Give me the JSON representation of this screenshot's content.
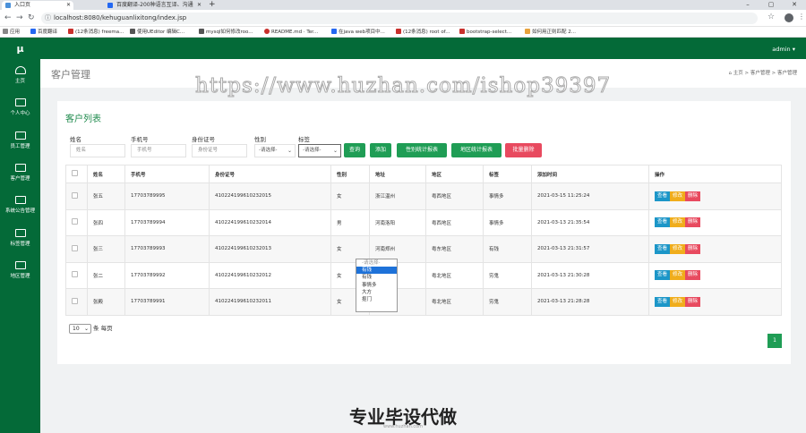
{
  "browser": {
    "tabs": [
      {
        "label": "入口页",
        "active": true
      },
      {
        "label": "百度翻译-200种语言互译、沟通",
        "active": false
      }
    ],
    "url": "localhost:8080/kehuguanlixitong/index.jsp",
    "bookmarks": [
      "应用",
      "百度翻译",
      "(12条消息) freema...",
      "使用UEditor 编辑C...",
      "mysql如何修改roo...",
      "README.md · Ter...",
      "在java web项目中...",
      "(12条消息) root of...",
      "bootstrap-select...",
      "如何用正则匹配 2..."
    ]
  },
  "sidebar": {
    "logo": "μ",
    "items": [
      {
        "label": "主页",
        "icon": "dashboard-icon"
      },
      {
        "label": "个人中心",
        "icon": "monitor-icon"
      },
      {
        "label": "员工管理",
        "icon": "monitor-icon"
      },
      {
        "label": "客户管理",
        "icon": "monitor-icon"
      },
      {
        "label": "系统公告管理",
        "icon": "monitor-icon"
      },
      {
        "label": "标签管理",
        "icon": "monitor-icon"
      },
      {
        "label": "地区管理",
        "icon": "monitor-icon"
      }
    ]
  },
  "topbar": {
    "user": "admin ▾"
  },
  "header": {
    "title": "客户管理",
    "breadcrumb": [
      "主页",
      "客户管理",
      "客户管理"
    ]
  },
  "watermark": "https://www.huzhan.com/ishop39397",
  "panel": {
    "title": "客户列表",
    "filters": {
      "name_label": "姓名",
      "name_placeholder": "姓名",
      "phone_label": "手机号",
      "phone_placeholder": "手机号",
      "idcard_label": "身份证号",
      "idcard_placeholder": "身份证号",
      "gender_label": "性别",
      "gender_value": "-请选择-",
      "tag_label": "标签",
      "tag_value": "-请选择-"
    },
    "buttons": {
      "search": "查询",
      "add": "添加",
      "gender_report": "性别统计报表",
      "region_report": "地区统计报表",
      "batch_delete": "批量删除"
    },
    "tag_options": [
      "-请选择-",
      "有钱",
      "有钱",
      "事情多",
      "大方",
      "抠门"
    ],
    "table": {
      "headers": [
        "",
        "姓名",
        "手机号",
        "身份证号",
        "性别",
        "地址",
        "地区",
        "标签",
        "添加时间",
        "操作"
      ],
      "rows": [
        {
          "name": "张五",
          "phone": "17703789995",
          "idcard": "410224199610232015",
          "gender": "女",
          "address": "浙江温州",
          "region": "粤西地区",
          "tag": "事情多",
          "time": "2021-03-15 11:25:24"
        },
        {
          "name": "张四",
          "phone": "17703789994",
          "idcard": "410224199610232014",
          "gender": "男",
          "address": "河南洛阳",
          "region": "粤西地区",
          "tag": "事情多",
          "time": "2021-03-13 21:35:54"
        },
        {
          "name": "张三",
          "phone": "17703789993",
          "idcard": "410224199610232013",
          "gender": "女",
          "address": "河南郑州",
          "region": "粤东地区",
          "tag": "有钱",
          "time": "2021-03-13 21:31:57"
        },
        {
          "name": "张二",
          "phone": "17703789992",
          "idcard": "410224199610232012",
          "gender": "女",
          "address": "浙江杭州",
          "region": "粤北地区",
          "tag": "穷鬼",
          "time": "2021-03-13 21:30:28"
        },
        {
          "name": "张殿",
          "phone": "17703789991",
          "idcard": "410224199610232011",
          "gender": "女",
          "address": "安阳幕",
          "region": "粤北地区",
          "tag": "穷鬼",
          "time": "2021-03-13 21:28:28"
        }
      ],
      "actions": {
        "view": "查看",
        "edit": "修改",
        "delete": "删除"
      }
    },
    "pagination": {
      "per_page": "10",
      "per_page_suffix": "条 每页",
      "current_page": "1"
    }
  },
  "promo": {
    "title": "专业毕设代做",
    "subtitle": "www.huzhan.com"
  },
  "colors": {
    "primary": "#046a38",
    "button_green": "#1f9d55",
    "button_red": "#e84a5f",
    "view_blue": "#1c96c8",
    "edit_orange": "#f0ad1c"
  }
}
